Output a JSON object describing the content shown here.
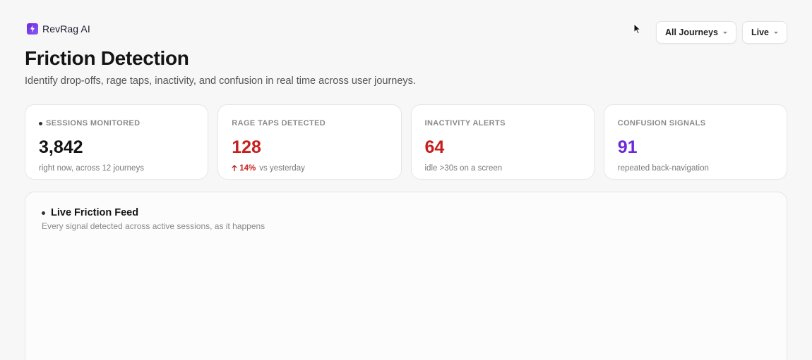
{
  "brand": {
    "name": "RevRag AI"
  },
  "controls": {
    "journey_filter": "All Journeys",
    "mode_filter": "Live"
  },
  "page": {
    "title": "Friction Detection",
    "subtitle": "Identify drop-offs, rage taps, inactivity, and confusion in real time across user journeys."
  },
  "cards": [
    {
      "label": "SESSIONS MONITORED",
      "value": "3,842",
      "note": "right now, across 12 journeys",
      "color": "#141414"
    },
    {
      "label": "RAGE TAPS DETECTED",
      "value": "128",
      "delta": "14%",
      "note": "vs yesterday",
      "color": "#c81e1e"
    },
    {
      "label": "INACTIVITY ALERTS",
      "value": "64",
      "note": "idle >30s on a screen",
      "color": "#c81e1e"
    },
    {
      "label": "CONFUSION SIGNALS",
      "value": "91",
      "note": "repeated back-navigation",
      "color": "#6d28d9"
    }
  ],
  "feed": {
    "title": "Live Friction Feed",
    "subtitle": "Every signal detected across active sessions, as it happens"
  }
}
